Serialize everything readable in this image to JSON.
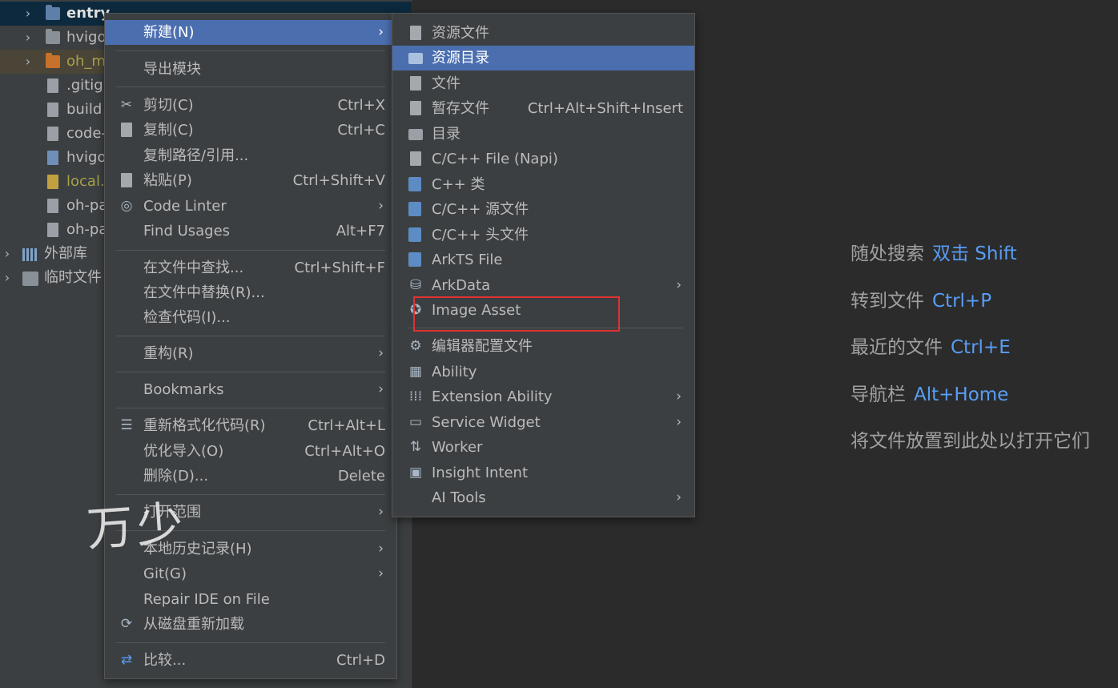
{
  "tree": {
    "items": [
      {
        "label": "entry",
        "bold": true
      },
      {
        "label": "hvigo"
      },
      {
        "label": "oh_m"
      },
      {
        "label": ".gitig"
      },
      {
        "label": "build"
      },
      {
        "label": "code-"
      },
      {
        "label": "hvigo"
      },
      {
        "label": "local."
      },
      {
        "label": "oh-pa"
      },
      {
        "label": "oh-pa"
      },
      {
        "label": "外部库"
      },
      {
        "label": "临时文件"
      }
    ]
  },
  "menu_main": {
    "items": [
      {
        "label": "新建(N)",
        "shortcut": "",
        "submenu": true
      },
      {
        "label": "导出模块",
        "shortcut": ""
      },
      {
        "label": "剪切(C)",
        "shortcut": "Ctrl+X"
      },
      {
        "label": "复制(C)",
        "shortcut": "Ctrl+C"
      },
      {
        "label": "复制路径/引用...",
        "shortcut": ""
      },
      {
        "label": "粘贴(P)",
        "shortcut": "Ctrl+Shift+V"
      },
      {
        "label": "Code Linter",
        "shortcut": "",
        "submenu": true
      },
      {
        "label": "Find Usages",
        "shortcut": "Alt+F7"
      },
      {
        "label": "在文件中查找...",
        "shortcut": "Ctrl+Shift+F"
      },
      {
        "label": "在文件中替换(R)...",
        "shortcut": ""
      },
      {
        "label": "检查代码(I)...",
        "shortcut": ""
      },
      {
        "label": "重构(R)",
        "shortcut": "",
        "submenu": true
      },
      {
        "label": "Bookmarks",
        "shortcut": "",
        "submenu": true
      },
      {
        "label": "重新格式化代码(R)",
        "shortcut": "Ctrl+Alt+L"
      },
      {
        "label": "优化导入(O)",
        "shortcut": "Ctrl+Alt+O"
      },
      {
        "label": "删除(D)...",
        "shortcut": "Delete"
      },
      {
        "label": "打开范围",
        "shortcut": "",
        "submenu": true
      },
      {
        "label": "本地历史记录(H)",
        "shortcut": "",
        "submenu": true
      },
      {
        "label": "Git(G)",
        "shortcut": "",
        "submenu": true
      },
      {
        "label": "Repair IDE on File",
        "shortcut": ""
      },
      {
        "label": "从磁盘重新加载",
        "shortcut": ""
      },
      {
        "label": "比较...",
        "shortcut": "Ctrl+D"
      }
    ]
  },
  "menu_new": {
    "items": [
      {
        "label": "资源文件",
        "shortcut": ""
      },
      {
        "label": "资源目录",
        "shortcut": ""
      },
      {
        "label": "文件",
        "shortcut": ""
      },
      {
        "label": "暂存文件",
        "shortcut": "Ctrl+Alt+Shift+Insert"
      },
      {
        "label": "目录",
        "shortcut": ""
      },
      {
        "label": "C/C++ File (Napi)",
        "shortcut": ""
      },
      {
        "label": "C++ 类",
        "shortcut": ""
      },
      {
        "label": "C/C++ 源文件",
        "shortcut": ""
      },
      {
        "label": "C/C++ 头文件",
        "shortcut": ""
      },
      {
        "label": "ArkTS File",
        "shortcut": ""
      },
      {
        "label": "ArkData",
        "shortcut": "",
        "submenu": true
      },
      {
        "label": "Image Asset",
        "shortcut": ""
      },
      {
        "label": "编辑器配置文件",
        "shortcut": ""
      },
      {
        "label": "Ability",
        "shortcut": ""
      },
      {
        "label": "Extension Ability",
        "shortcut": "",
        "submenu": true
      },
      {
        "label": "Service Widget",
        "shortcut": "",
        "submenu": true
      },
      {
        "label": "Worker",
        "shortcut": ""
      },
      {
        "label": "Insight Intent",
        "shortcut": ""
      },
      {
        "label": "AI Tools",
        "shortcut": "",
        "submenu": true
      }
    ]
  },
  "hints": [
    {
      "text": "随处搜索",
      "key": "双击 Shift"
    },
    {
      "text": "转到文件",
      "key": "Ctrl+P"
    },
    {
      "text": "最近的文件",
      "key": "Ctrl+E"
    },
    {
      "text": "导航栏",
      "key": "Alt+Home"
    },
    {
      "text": "将文件放置到此处以打开它们",
      "key": ""
    }
  ],
  "watermark": "万少",
  "symbols": {
    "expand": "›",
    "submenu": "›"
  },
  "colors": {
    "accent": "#4b6eaf",
    "link": "#589df6",
    "highlight_box": "#e03131"
  }
}
